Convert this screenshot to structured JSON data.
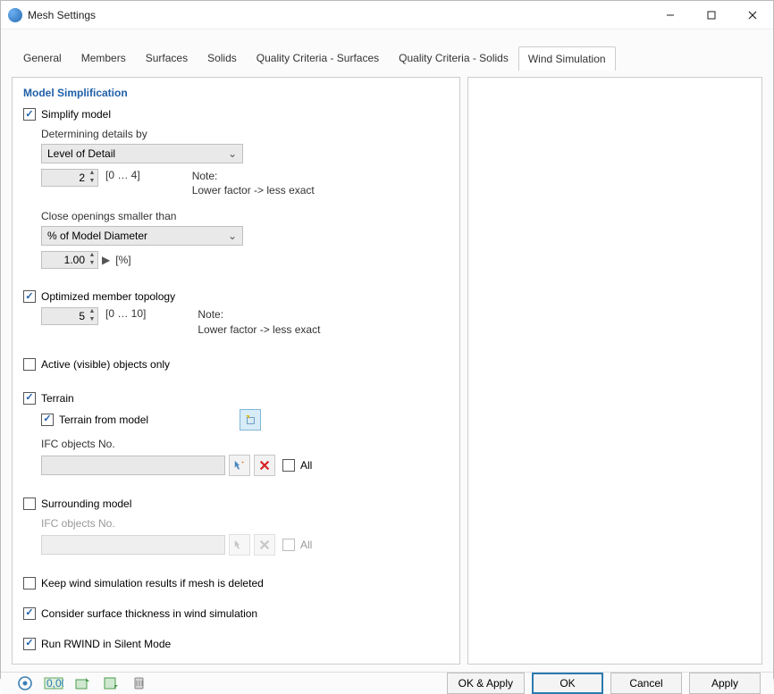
{
  "window": {
    "title": "Mesh Settings"
  },
  "tabs": [
    "General",
    "Members",
    "Surfaces",
    "Solids",
    "Quality Criteria - Surfaces",
    "Quality Criteria - Solids",
    "Wind Simulation"
  ],
  "active_tab_index": 6,
  "section_title": "Model Simplification",
  "simplify": {
    "checked": true,
    "label": "Simplify model",
    "detail": {
      "label": "Determining details by",
      "combo": "Level of Detail",
      "value": "2",
      "range": "[0 … 4]",
      "note_title": "Note:",
      "note_body": "Lower factor -> less exact"
    },
    "openings": {
      "label": "Close openings smaller than",
      "combo": "% of Model Diameter",
      "value": "1.00",
      "unit": "[%]"
    }
  },
  "optimized": {
    "checked": true,
    "label": "Optimized member topology",
    "value": "5",
    "range": "[0 … 10]",
    "note_title": "Note:",
    "note_body": "Lower factor -> less exact"
  },
  "active_visible": {
    "checked": false,
    "label": "Active (visible) objects only"
  },
  "terrain": {
    "checked": true,
    "label": "Terrain",
    "from_model": {
      "checked": true,
      "label": "Terrain from model"
    },
    "ifc_label": "IFC objects No.",
    "all_label": "All",
    "all_checked": false
  },
  "surrounding": {
    "checked": false,
    "label": "Surrounding model",
    "ifc_label": "IFC objects No.",
    "all_label": "All",
    "all_checked": false
  },
  "keep_results": {
    "checked": false,
    "label": "Keep wind simulation results if mesh is deleted"
  },
  "consider_thickness": {
    "checked": true,
    "label": "Consider surface thickness in wind simulation"
  },
  "silent_mode": {
    "checked": true,
    "label": "Run RWIND in Silent Mode"
  },
  "buttons": {
    "ok_apply": "OK & Apply",
    "ok": "OK",
    "cancel": "Cancel",
    "apply": "Apply"
  }
}
